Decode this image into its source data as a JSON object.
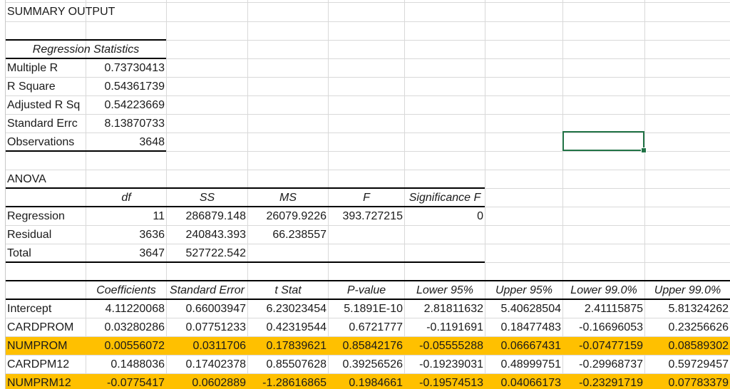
{
  "summary_title": "SUMMARY OUTPUT",
  "regression_statistics": {
    "header": "Regression Statistics",
    "rows": [
      {
        "label": "Multiple R",
        "value": "0.73730413"
      },
      {
        "label": "R Square",
        "value": "0.54361739"
      },
      {
        "label": "Adjusted R Sq",
        "value": "0.54223669"
      },
      {
        "label": "Standard Errc",
        "value": "8.13870733"
      },
      {
        "label": "Observations",
        "value": "3648"
      }
    ]
  },
  "anova": {
    "title": "ANOVA",
    "headers": [
      "df",
      "SS",
      "MS",
      "F",
      "Significance F"
    ],
    "rows": [
      {
        "label": "Regression",
        "values": [
          "11",
          "286879.148",
          "26079.9226",
          "393.727215",
          "0"
        ]
      },
      {
        "label": "Residual",
        "values": [
          "3636",
          "240843.393",
          "66.238557",
          "",
          ""
        ]
      },
      {
        "label": "Total",
        "values": [
          "3647",
          "527722.542",
          "",
          "",
          ""
        ]
      }
    ]
  },
  "coefficients": {
    "headers": [
      "Coefficients",
      "Standard Error",
      "t Stat",
      "P-value",
      "Lower 95%",
      "Upper 95%",
      "Lower 99.0%",
      "Upper 99.0%"
    ],
    "rows": [
      {
        "label": "Intercept",
        "highlight": false,
        "values": [
          "4.11220068",
          "0.66003947",
          "6.23023454",
          "5.1891E-10",
          "2.81811632",
          "5.40628504",
          "2.41115875",
          "5.81324262"
        ]
      },
      {
        "label": "CARDPROM",
        "highlight": false,
        "values": [
          "0.03280286",
          "0.07751233",
          "0.42319544",
          "0.6721777",
          "-0.1191691",
          "0.18477483",
          "-0.16696053",
          "0.23256626"
        ]
      },
      {
        "label": "NUMPROM",
        "highlight": true,
        "values": [
          "0.00556072",
          "0.0311706",
          "0.17839621",
          "0.85842176",
          "-0.05555288",
          "0.06667431",
          "-0.07477159",
          "0.08589302"
        ]
      },
      {
        "label": "CARDPM12",
        "highlight": false,
        "values": [
          "0.1488036",
          "0.17402378",
          "0.85507628",
          "0.39256526",
          "-0.19239031",
          "0.48999751",
          "-0.29968737",
          "0.59729457"
        ]
      },
      {
        "label": "NUMPRM12",
        "highlight": true,
        "values": [
          "-0.0775417",
          "0.0602889",
          "-1.28616865",
          "0.1984661",
          "-0.19574513",
          "0.04066173",
          "-0.23291719",
          "0.07783379"
        ]
      }
    ]
  },
  "highlight_color": "#ffc000",
  "selection_color": "#217346"
}
